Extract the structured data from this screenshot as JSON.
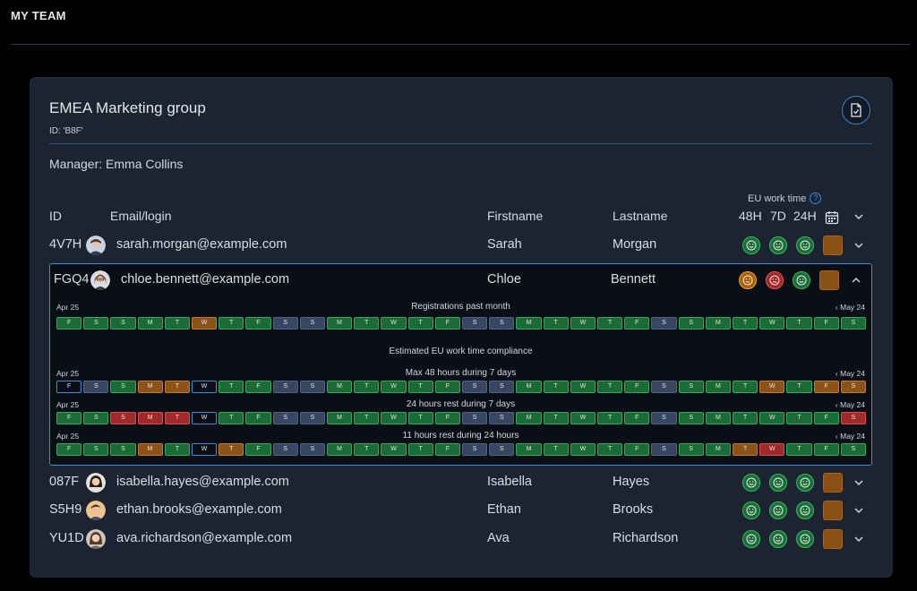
{
  "page": {
    "title": "MY TEAM"
  },
  "group": {
    "name": "EMEA Marketing group",
    "id_label": "ID: 'B8F'",
    "manager": "Manager: Emma Collins",
    "eu_label": "EU work time"
  },
  "columns": {
    "id": "ID",
    "email": "Email/login",
    "firstname": "Firstname",
    "lastname": "Lastname",
    "h48": "48H",
    "d7": "7D",
    "h24": "24H"
  },
  "members": [
    {
      "id": "4V7H",
      "email": "sarah.morgan@example.com",
      "firstname": "Sarah",
      "lastname": "Morgan",
      "status": [
        "good",
        "good",
        "good"
      ]
    },
    {
      "id": "FGQ4",
      "email": "chloe.bennett@example.com",
      "firstname": "Chloe",
      "lastname": "Bennett",
      "status": [
        "warn",
        "bad",
        "good"
      ]
    },
    {
      "id": "087F",
      "email": "isabella.hayes@example.com",
      "firstname": "Isabella",
      "lastname": "Hayes",
      "status": [
        "good",
        "good",
        "good"
      ]
    },
    {
      "id": "S5H9",
      "email": "ethan.brooks@example.com",
      "firstname": "Ethan",
      "lastname": "Brooks",
      "status": [
        "good",
        "good",
        "good"
      ]
    },
    {
      "id": "YU1D",
      "email": "ava.richardson@example.com",
      "firstname": "Ava",
      "lastname": "Richardson",
      "status": [
        "good",
        "good",
        "good"
      ]
    }
  ],
  "details": {
    "start_date": "Apr 25",
    "end_date": "‹ May 24",
    "registrations_title": "Registrations past month",
    "compliance_title": "Estimated EU work time compliance",
    "strips": [
      {
        "title": "Registrations past month",
        "has_date": true,
        "days": [
          "F",
          "S",
          "S",
          "M",
          "T",
          "W",
          "T",
          "F",
          "S",
          "S",
          "M",
          "T",
          "W",
          "T",
          "F",
          "S",
          "S",
          "M",
          "T",
          "W",
          "T",
          "F",
          "S",
          "S",
          "M",
          "T",
          "W",
          "T",
          "F",
          "S"
        ],
        "styles": [
          "g",
          "g",
          "g",
          "g",
          "g",
          "o",
          "g",
          "g",
          "w",
          "w",
          "g",
          "g",
          "g",
          "g",
          "g",
          "w",
          "w",
          "g",
          "g",
          "g",
          "g",
          "g",
          "w",
          "g",
          "g",
          "g",
          "g",
          "g",
          "g",
          "g"
        ]
      },
      {
        "title": "Max 48 hours during 7 days",
        "has_date": true,
        "days": [
          "F",
          "S",
          "S",
          "M",
          "T",
          "W",
          "T",
          "F",
          "S",
          "S",
          "M",
          "T",
          "W",
          "T",
          "F",
          "S",
          "S",
          "M",
          "T",
          "W",
          "T",
          "F",
          "S",
          "S",
          "M",
          "T",
          "W",
          "T",
          "F",
          "S"
        ],
        "styles": [
          "b",
          "w",
          "g",
          "o",
          "o",
          "b",
          "g",
          "g",
          "w",
          "w",
          "g",
          "g",
          "g",
          "g",
          "g",
          "w",
          "w",
          "g",
          "g",
          "g",
          "g",
          "g",
          "w",
          "g",
          "g",
          "g",
          "o",
          "g",
          "o",
          "o"
        ]
      },
      {
        "title": "24 hours rest during 7 days",
        "has_date": true,
        "days": [
          "F",
          "S",
          "S",
          "M",
          "T",
          "W",
          "T",
          "F",
          "S",
          "S",
          "M",
          "T",
          "W",
          "T",
          "F",
          "S",
          "S",
          "M",
          "T",
          "W",
          "T",
          "F",
          "S",
          "S",
          "M",
          "T",
          "W",
          "T",
          "F",
          "S"
        ],
        "styles": [
          "g",
          "g",
          "r",
          "r",
          "r",
          "b",
          "g",
          "g",
          "w",
          "w",
          "g",
          "g",
          "g",
          "g",
          "g",
          "w",
          "w",
          "g",
          "g",
          "g",
          "g",
          "g",
          "w",
          "g",
          "g",
          "g",
          "g",
          "g",
          "g",
          "r"
        ]
      },
      {
        "title": "11 hours rest during 24 hours",
        "has_date": true,
        "days": [
          "F",
          "S",
          "S",
          "M",
          "T",
          "W",
          "T",
          "F",
          "S",
          "S",
          "M",
          "T",
          "W",
          "T",
          "F",
          "S",
          "S",
          "M",
          "T",
          "W",
          "T",
          "F",
          "S",
          "S",
          "M",
          "T",
          "W",
          "T",
          "F",
          "S"
        ],
        "styles": [
          "g",
          "g",
          "g",
          "o",
          "g",
          "b",
          "o",
          "g",
          "w",
          "w",
          "g",
          "g",
          "g",
          "g",
          "g",
          "w",
          "w",
          "g",
          "g",
          "g",
          "g",
          "g",
          "w",
          "g",
          "g",
          "o",
          "r",
          "g",
          "g",
          "g"
        ]
      }
    ]
  },
  "colors": {
    "accent": "#3a8fd6",
    "good": "#1f6a38",
    "warn": "#a8620f",
    "bad": "#a02a2a"
  }
}
